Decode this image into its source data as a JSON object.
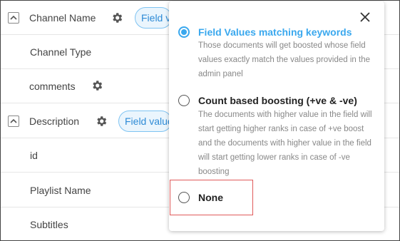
{
  "fields": [
    {
      "label": "Channel Name",
      "expandable": true,
      "gear": true,
      "pill": "Field values matching keywords"
    },
    {
      "label": "Channel Type",
      "expandable": false,
      "gear": false,
      "pill": ""
    },
    {
      "label": "comments",
      "expandable": false,
      "gear": true,
      "pill": ""
    },
    {
      "label": "Description",
      "expandable": true,
      "gear": true,
      "pill": "Field values matching keywords"
    },
    {
      "label": "id",
      "expandable": false,
      "gear": false,
      "pill": ""
    },
    {
      "label": "Playlist Name",
      "expandable": false,
      "gear": false,
      "pill": ""
    },
    {
      "label": "Subtitles",
      "expandable": false,
      "gear": false,
      "pill": ""
    }
  ],
  "popover": {
    "options": [
      {
        "title": "Field Values matching keywords",
        "description": "Those documents will get boosted whose field values exactly match the values provided in the admin panel",
        "selected": true
      },
      {
        "title": "Count based boosting (+ve & -ve)",
        "description": "The documents with higher value in the field will start getting higher ranks in case of +ve boost and the documents with higher value in the field will start getting lower ranks in case of -ve boosting",
        "selected": false
      },
      {
        "title": "None",
        "description": "",
        "selected": false
      }
    ]
  },
  "colors": {
    "accent": "#3aa8ee",
    "highlight": "#e05a5a"
  },
  "icons": {
    "gear": "gear-icon",
    "expand": "chevron-up-icon",
    "close": "close-icon"
  }
}
